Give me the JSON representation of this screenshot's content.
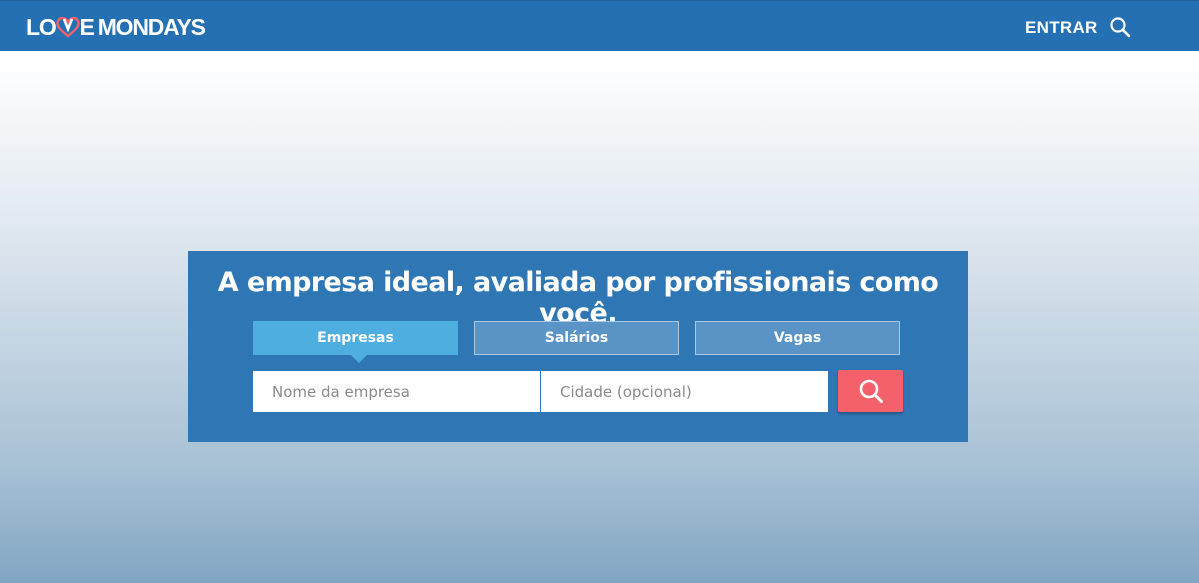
{
  "header": {
    "logo_part1": "LO",
    "logo_part2": "E",
    "logo_part3": "MONDAYS",
    "login_label": "ENTRAR"
  },
  "hero": {
    "headline": "A empresa ideal, avaliada por profissionais como você.",
    "tabs": [
      {
        "label": "Empresas",
        "active": true
      },
      {
        "label": "Salários",
        "active": false
      },
      {
        "label": "Vagas",
        "active": false
      }
    ],
    "company_placeholder": "Nome da empresa",
    "city_placeholder": "Cidade (opcional)"
  },
  "colors": {
    "header_bg": "#2570b3",
    "hero_bg": "#2f76b5",
    "active_tab": "#4eaee0",
    "inactive_tab": "#5a94c6",
    "search_button": "#f5616b",
    "logo_heart": "#f5616b"
  },
  "icons": {
    "header_search": "search-icon",
    "logo_heart": "heart-icon",
    "hero_search": "search-icon"
  }
}
